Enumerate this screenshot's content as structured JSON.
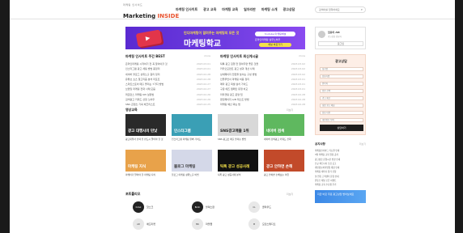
{
  "header": {
    "logo_small": "마케팅 인사이드",
    "logo_prefix": "Marketing ",
    "logo_highlight": "INSIDE",
    "nav": [
      "마케팅 인사이트",
      "광고 교육",
      "마케팅 교육",
      "일자리판",
      "마케팅 소개",
      "광고상담"
    ],
    "search_placeholder": "검색어를 입력하세요"
  },
  "banner": {
    "top_text": "인디마케팅이 알려주는 마케팅의 모든 것",
    "title": "마케팅학교",
    "badge": "Youtube 마케팅채널",
    "sub": "온라인마케팅 실무노하우",
    "button": "채널 바로가기"
  },
  "news_left": {
    "title": "마케팅 인사이트 주간 BEST",
    "more": "more",
    "items": [
      {
        "t": "온라인마케팅 시작하기 전 꼭 알아야할 것",
        "d": "2023.03.01"
      },
      {
        "t": "인스타그램 광고 세팅 방법 총정리",
        "d": "2023.03.01"
      },
      {
        "t": "네이버 블로그 상위노출 원리 정리",
        "d": "2023.02.28"
      },
      {
        "t": "유튜브 쇼츠 알고리즘 분석 리포트",
        "d": "2023.02.28"
      },
      {
        "t": "스마트스토어 매출 올리는 7가지 방법",
        "d": "2023.02.27"
      },
      {
        "t": "브랜딩 마케팅 전략 사례 모음",
        "d": "2023.02.27"
      },
      {
        "t": "퍼포먼스 마케팅 KPI 설정법",
        "d": "2023.02.26"
      },
      {
        "t": "검색광고 키워드 선정 노하우",
        "d": "2023.02.26"
      },
      {
        "t": "SNS 콘텐츠 기획 체크리스트",
        "d": "2023.02.25"
      }
    ]
  },
  "news_right": {
    "title": "마케팅 인사이트 최신게시글",
    "more": "more",
    "items": [
      {
        "t": "틱톡 광고 집행 전 알아두면 좋은 것들",
        "d": "2023.03.02"
      },
      {
        "t": "카카오모먼트 광고 성과 개선 사례",
        "d": "2023.03.02"
      },
      {
        "t": "상세페이지 전환율 높이는 구성 방법",
        "d": "2023.03.02"
      },
      {
        "t": "인플루언서 마케팅 비용 정리",
        "d": "2023.03.01"
      },
      {
        "t": "메타 광고 픽셀 설치 가이드",
        "d": "2023.03.01"
      },
      {
        "t": "구글 애즈 캠페인 유형 비교",
        "d": "2023.03.01"
      },
      {
        "t": "리타겟팅 광고 운영 팁",
        "d": "2023.02.28"
      },
      {
        "t": "랜딩페이지 A/B 테스트 방법",
        "d": "2023.02.28"
      },
      {
        "t": "마케팅 예산 짜는 법",
        "d": "2023.02.28"
      }
    ]
  },
  "edu": {
    "title": "영상교육",
    "more": "더보기",
    "videos": [
      {
        "thumb": "광고 대행사의 민낯",
        "cap": "광고대행사 선택 전 반드시 알아야 할 것",
        "bg": "#2a2a2a"
      },
      {
        "thumb": "인스타그램",
        "cap": "인스타그램 마케팅 완벽 가이드",
        "bg": "#3a9fb5"
      },
      {
        "thumb": "SNS광고매출 1위",
        "cap": "SNS 광고로 매출 올리는 방법",
        "bg": "#d8d8d8"
      },
      {
        "thumb": "네이버 검색",
        "cap": "네이버 검색광고 키워드 전략",
        "bg": "#5fb85f"
      },
      {
        "thumb": "마케팅 지식",
        "cap": "마케터가 알아야 할 마케팅 지식",
        "bg": "#e8a24a"
      },
      {
        "thumb": "블로그 마케팅",
        "cap": "블로그 마케팅 상위노출 비법",
        "bg": "#d4d8e8"
      },
      {
        "thumb": "틱톡 광고 성공사례",
        "cap": "틱톡 광고 성공사례 분석",
        "bg": "#111111"
      },
      {
        "thumb": "광고 안하면 손해",
        "cap": "광고 안하면 손해보는 이유",
        "bg": "#c24a2a"
      }
    ]
  },
  "channels": {
    "title": "포트폴리오",
    "more": "더보기",
    "items": [
      {
        "avatar": "hotsk",
        "name": "핫스크"
      },
      {
        "avatar": "BLSC",
        "name": "블랙스완"
      },
      {
        "avatar": "CL",
        "name": "클라우드"
      },
      {
        "avatar": "AD",
        "name": "애드마켓"
      },
      {
        "avatar": "MK",
        "name": "마켓랩"
      },
      {
        "avatar": "M",
        "name": "모던스튜디오"
      }
    ]
  },
  "login": {
    "name": "임유미 AM",
    "sub": "광고상담 담당자",
    "button": "로그인"
  },
  "ad_form": {
    "title": "광고상담",
    "fields": [
      "회사명",
      "담당자명",
      "연락처",
      "업종 선택",
      "광고 예산",
      "희망 광고 채널",
      "상담 내용",
      "개인정보 동의"
    ],
    "submit": "상담하기"
  },
  "side_news": {
    "title": "공지사항",
    "more": "더보기",
    "items": [
      "마케팅인사이드 리뉴얼 안내",
      "3월 마케팅 교육 일정 공지",
      "광고상담 운영시간 변경 안내",
      "신규 파트너사 모집 공고",
      "개인정보처리방침 개정 안내",
      "마케팅 세미나 참가 신청",
      "설 연휴 고객센터 운영 안내",
      "유튜브 채널 오픈 이벤트",
      "마케팅 교육 수료생 후기"
    ]
  },
  "side_banner": {
    "text": "지금 바로 무료 광고상담 받아보세요"
  }
}
